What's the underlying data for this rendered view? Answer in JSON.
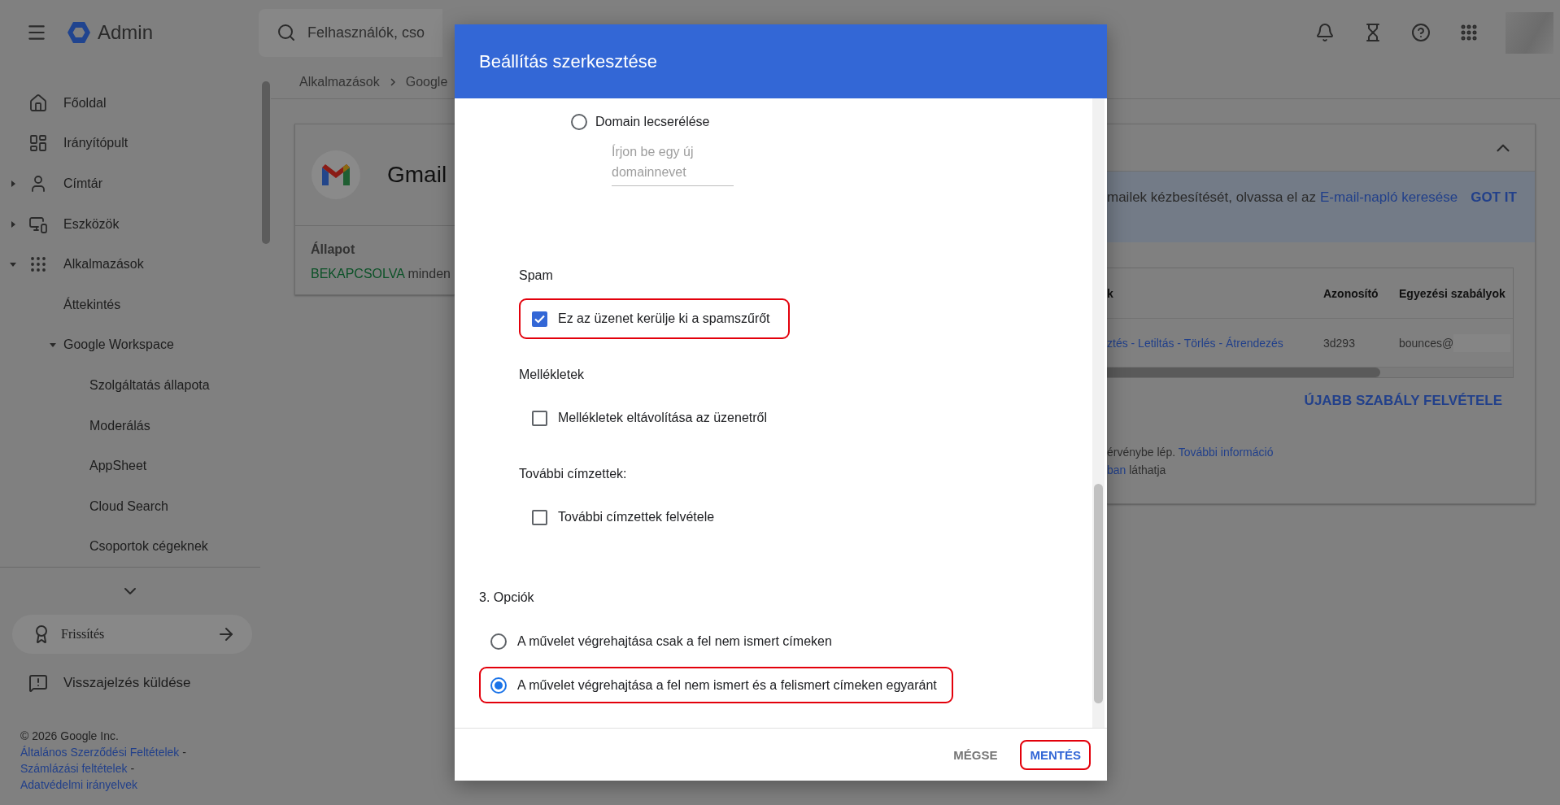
{
  "topbar": {
    "product": "Admin",
    "search": {
      "placeholder": "Felhasználók, cso"
    }
  },
  "breadcrumb": [
    "Alkalmazások",
    "Google"
  ],
  "sidebar": {
    "items": [
      {
        "label": "Főoldal"
      },
      {
        "label": "Irányítópult"
      },
      {
        "label": "Címtár",
        "expanded": false
      },
      {
        "label": "Eszközök",
        "expanded": false
      },
      {
        "label": "Alkalmazások",
        "expanded": true,
        "children": [
          {
            "label": "Áttekintés"
          },
          {
            "label": "Google Workspace",
            "expanded": true,
            "children": [
              {
                "label": "Szolgáltatás állapota"
              },
              {
                "label": "Moderálás"
              },
              {
                "label": "AppSheet"
              },
              {
                "label": "Cloud Search"
              },
              {
                "label": "Csoportok cégeknek"
              }
            ]
          }
        ]
      }
    ],
    "upgrade": "Frissítés",
    "feedback": "Visszajelzés küldése",
    "copyright": "© 2026 Google Inc.",
    "separator": "-",
    "links": [
      "Általános Szerződési Feltételek",
      "Számlázási feltételek",
      "Adatvédelmi irányelvek"
    ]
  },
  "app_card": {
    "title": "Gmail",
    "status_label": "Állapot",
    "status_value": "BEKAPCSOLVA",
    "status_rest": "minden"
  },
  "routing_card": {
    "banner": {
      "text": "mailek kézbesítését, olvassa el az",
      "link": "E-mail-napló keresése",
      "button": "GOT IT"
    },
    "table": {
      "columns": [
        "k",
        "Azonosító",
        "Egyezési szabályok"
      ],
      "rows": [
        {
          "actions": "ztés - Letiltás - Törlés - Átrendezés",
          "id": "3d293",
          "match": "bounces@"
        }
      ]
    },
    "add_button": "ÚJABB SZABÁLY FELVÉTELE",
    "notes": [
      [
        {
          "text": "érvénybe lép.",
          "link": false
        },
        {
          "text": "További információ",
          "link": true
        }
      ],
      [
        {
          "text": "ban",
          "link": true
        },
        {
          "text": "láthatja",
          "link": false
        }
      ]
    ]
  },
  "dialog": {
    "title": "Beállítás szerkesztése",
    "replace_domain": {
      "option": {
        "label": "Domain lecserélése",
        "selected": false
      },
      "field": {
        "placeholder": "Írjon be egy új domainnevet"
      }
    },
    "groups": [
      {
        "heading": "Spam",
        "items": [
          {
            "label": "Ez az üzenet kerülje ki a spamszűrőt",
            "checked": true,
            "highlighted": true
          }
        ]
      },
      {
        "heading": "Mellékletek",
        "items": [
          {
            "label": "Mellékletek eltávolítása az üzenetről",
            "checked": false,
            "highlighted": false
          }
        ]
      },
      {
        "heading": "További címzettek:",
        "items": [
          {
            "label": "További címzettek felvétele",
            "checked": false,
            "highlighted": false
          }
        ]
      }
    ],
    "options": {
      "heading": "3. Opciók",
      "choices": [
        {
          "label": "A művelet végrehajtása csak a fel nem ismert címeken",
          "selected": false,
          "highlighted": false
        },
        {
          "label": "A művelet végrehajtása a fel nem ismert és a felismert címeken egyaránt",
          "selected": true,
          "highlighted": true
        }
      ]
    },
    "buttons": [
      {
        "label": "MÉGSE",
        "kind": "secondary",
        "highlighted": false
      },
      {
        "label": "MENTÉS",
        "kind": "primary",
        "highlighted": true
      }
    ]
  }
}
